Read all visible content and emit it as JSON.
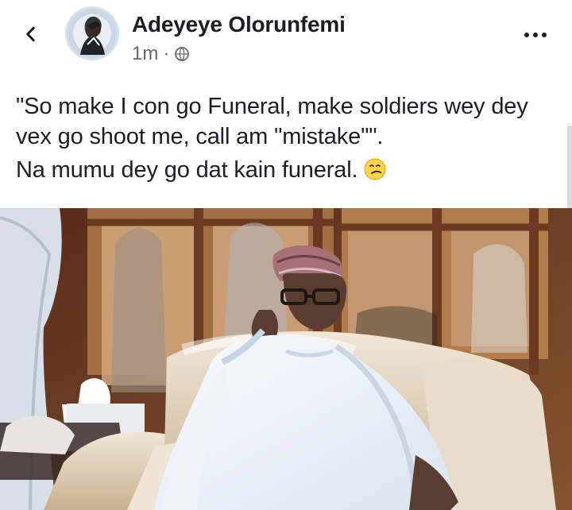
{
  "header": {
    "back_icon": "chevron-left-icon",
    "author_name": "Adeyeye Olorunfemi",
    "timestamp": "1m",
    "separator": "·",
    "privacy_icon": "globe-icon",
    "more_icon": "more-dots-icon"
  },
  "post": {
    "line1": "\"So make I con go Funeral, make soldiers wey dey vex go shoot me, call am \"mistake\"\".",
    "line2": "Na mumu dey go dat kain funeral.",
    "emoji_icon": "smirk-emoji-icon"
  },
  "image": {
    "subject": "man in white traditional attire seated on a sofa"
  },
  "colors": {
    "text": "#1c1e21",
    "meta": "#65676b",
    "background": "#ffffff",
    "wood": "#8a5a34",
    "sofa": "#e6d9c6"
  }
}
